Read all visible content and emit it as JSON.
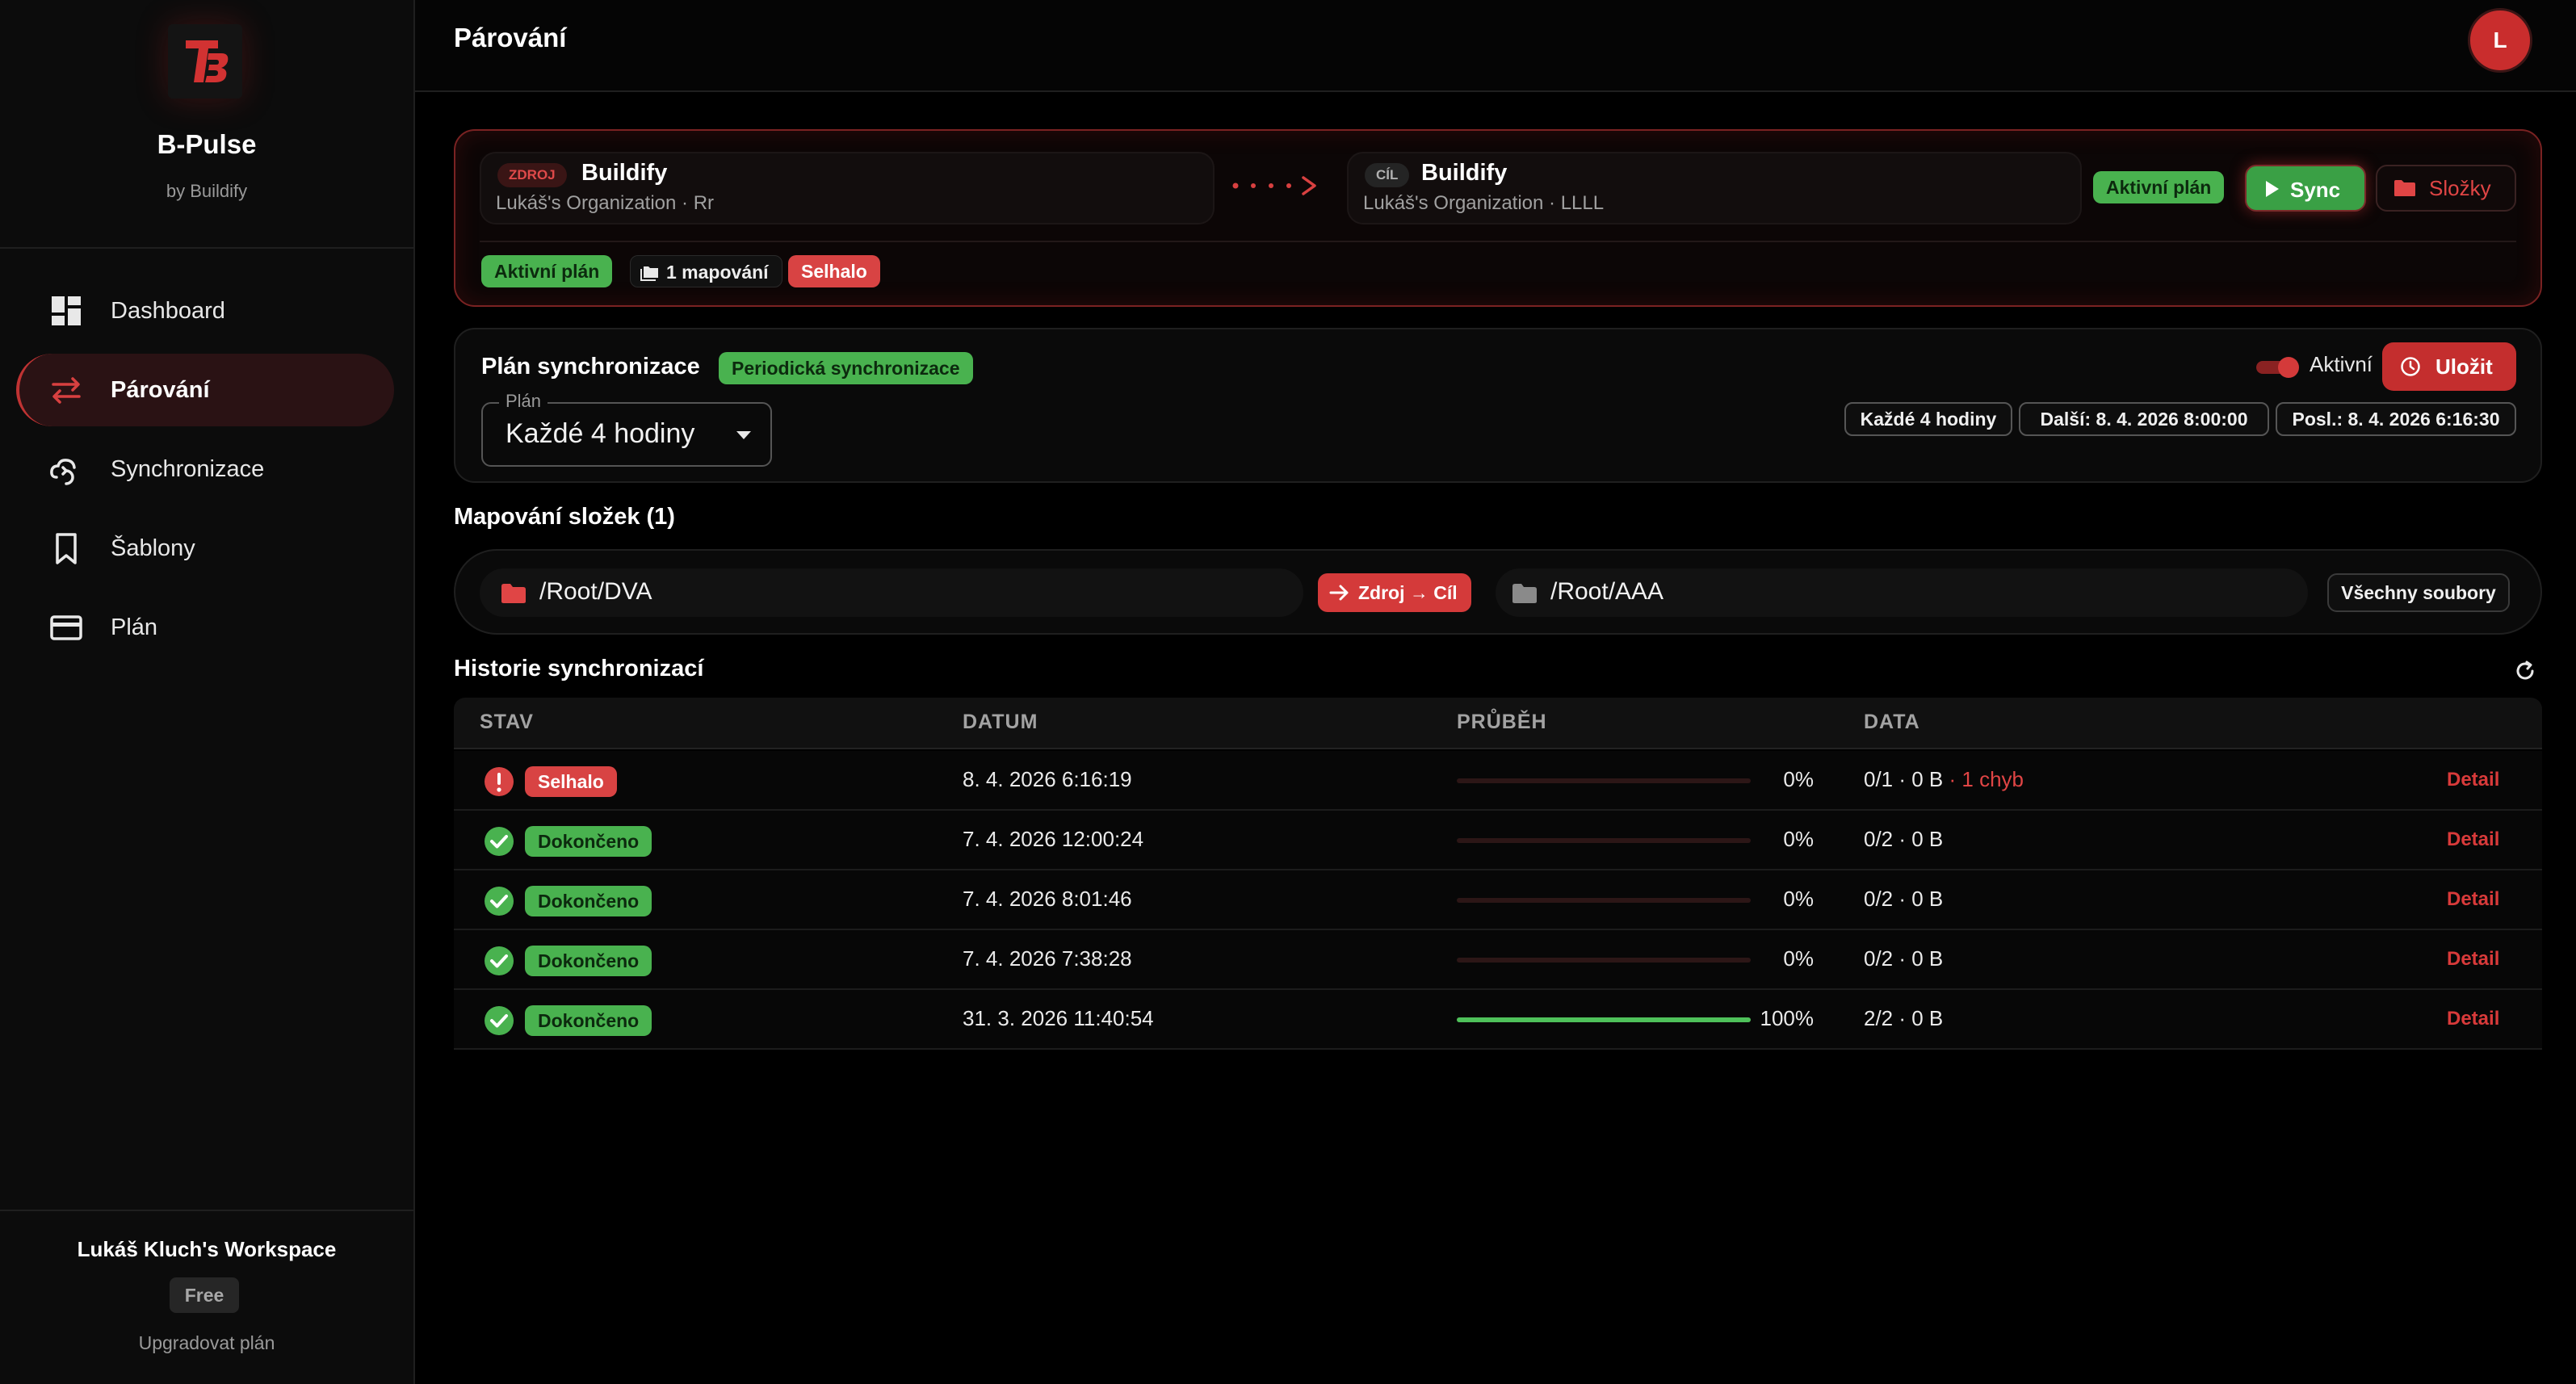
{
  "brand": {
    "name": "B-Pulse",
    "sub": "by Buildify"
  },
  "nav": [
    {
      "label": "Dashboard"
    },
    {
      "label": "Párování"
    },
    {
      "label": "Synchronizace"
    },
    {
      "label": "Šablony"
    },
    {
      "label": "Plán"
    }
  ],
  "workspace": {
    "name": "Lukáš Kluch's Workspace",
    "plan": "Free",
    "upgrade": "Upgradovat plán"
  },
  "header": {
    "title": "Párování",
    "avatar": "L"
  },
  "pair": {
    "source": {
      "tag": "ZDROJ",
      "name": "Buildify",
      "sub": "Lukáš's Organization · Rr"
    },
    "target": {
      "tag": "CÍL",
      "name": "Buildify",
      "sub": "Lukáš's Organization · LLLL"
    },
    "active_plan": "Aktivní plán",
    "sync_label": "Sync",
    "folders_label": "Složky",
    "badges": {
      "active": "Aktivní plán",
      "mappings": "1 mapování",
      "failed": "Selhalo"
    }
  },
  "schedule": {
    "title": "Plán synchronizace",
    "type_badge": "Periodická synchronizace",
    "select_legend": "Plán",
    "select_value": "Každé 4 hodiny",
    "toggle_label": "Aktivní",
    "save_label": "Uložit",
    "chips": {
      "interval": "Každé 4 hodiny",
      "next": "Další: 8. 4. 2026 8:00:00",
      "last": "Posl.: 8. 4. 2026 6:16:30"
    }
  },
  "mapping": {
    "title": "Mapování složek (1)",
    "source_path": "/Root/DVA",
    "direction": "Zdroj → Cíl",
    "target_path": "/Root/AAA",
    "filter": "Všechny soubory"
  },
  "history": {
    "title": "Historie synchronizací",
    "columns": {
      "status": "STAV",
      "date": "DATUM",
      "progress": "PRŮBĚH",
      "data": "DATA"
    },
    "detail_label": "Detail",
    "rows": [
      {
        "status": "Selhalo",
        "kind": "error",
        "date": "8. 4. 2026 6:16:19",
        "progress": 0,
        "pct": "0%",
        "data": "0/1 · 0 B",
        "errors": " · 1 chyb"
      },
      {
        "status": "Dokončeno",
        "kind": "ok",
        "date": "7. 4. 2026 12:00:24",
        "progress": 0,
        "pct": "0%",
        "data": "0/2 · 0 B",
        "errors": ""
      },
      {
        "status": "Dokončeno",
        "kind": "ok",
        "date": "7. 4. 2026 8:01:46",
        "progress": 0,
        "pct": "0%",
        "data": "0/2 · 0 B",
        "errors": ""
      },
      {
        "status": "Dokončeno",
        "kind": "ok",
        "date": "7. 4. 2026 7:38:28",
        "progress": 0,
        "pct": "0%",
        "data": "0/2 · 0 B",
        "errors": ""
      },
      {
        "status": "Dokončeno",
        "kind": "ok",
        "date": "31. 3. 2026 11:40:54",
        "progress": 1,
        "pct": "100%",
        "data": "2/2 · 0 B",
        "errors": ""
      }
    ]
  },
  "colors": {
    "accent": "#c92d2d",
    "success": "#49b24f",
    "background": "#000000"
  }
}
